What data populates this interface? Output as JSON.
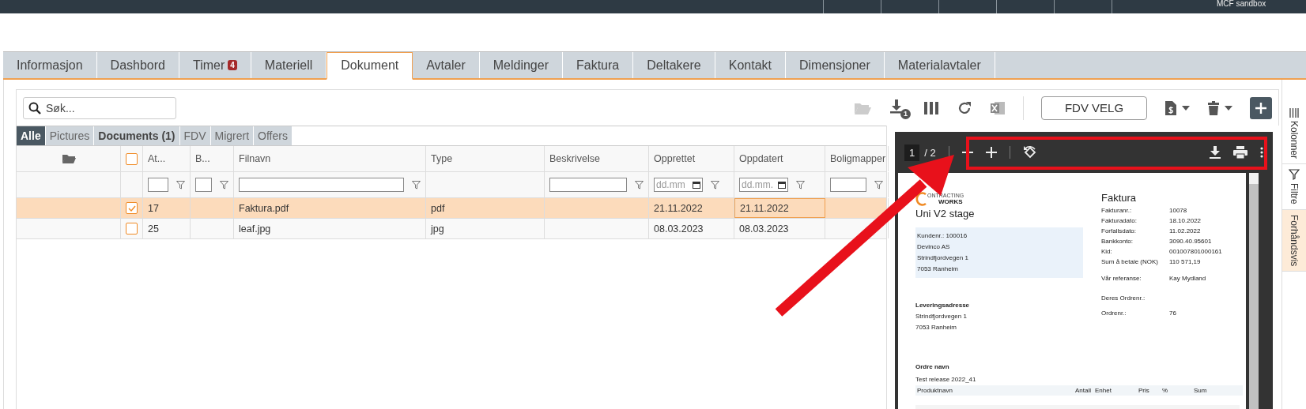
{
  "header": {
    "account": "MCF sandbox"
  },
  "tabs": [
    {
      "label": "Informasjon",
      "selected": false
    },
    {
      "label": "Dashbord",
      "selected": false
    },
    {
      "label": "Timer",
      "badge": "4",
      "selected": false
    },
    {
      "label": "Materiell",
      "selected": false
    },
    {
      "label": "Dokument",
      "selected": true
    },
    {
      "label": "Avtaler",
      "selected": false
    },
    {
      "label": "Meldinger",
      "selected": false
    },
    {
      "label": "Faktura",
      "selected": false
    },
    {
      "label": "Deltakere",
      "selected": false
    },
    {
      "label": "Kontakt",
      "selected": false
    },
    {
      "label": "Dimensjoner",
      "selected": false
    },
    {
      "label": "Materialavtaler",
      "selected": false
    }
  ],
  "search": {
    "placeholder": "Søk..."
  },
  "toolbar": {
    "download_badge": "1",
    "fdv_button": "FDV VELG"
  },
  "side_tabs": [
    {
      "label": "Kolonner",
      "kind": "plain",
      "selected": false
    },
    {
      "label": "Filtre",
      "kind": "filter",
      "selected": false
    },
    {
      "label": "Forhåndsvis",
      "kind": "plain",
      "selected": true
    }
  ],
  "categories": [
    {
      "label": "Alle",
      "selected": true
    },
    {
      "label": "Pictures",
      "selected": false
    },
    {
      "label": "Documents (1)",
      "selected": false
    },
    {
      "label": "FDV",
      "selected": false
    },
    {
      "label": "Migrert",
      "selected": false
    },
    {
      "label": "Offers",
      "selected": false
    }
  ],
  "header_checkbox": {
    "checked": false
  },
  "columns": [
    {
      "label": "At...",
      "kind": "text"
    },
    {
      "label": "B...",
      "kind": "text"
    },
    {
      "label": "Filnavn",
      "kind": "text"
    },
    {
      "label": "Type",
      "kind": "plain"
    },
    {
      "label": "Beskrivelse",
      "kind": "text"
    },
    {
      "label": "Opprettet",
      "kind": "date",
      "placeholder": "dd.mm"
    },
    {
      "label": "Oppdatert",
      "kind": "date",
      "placeholder": "dd.mm."
    },
    {
      "label": "Boligmapper",
      "kind": "text"
    }
  ],
  "rows": [
    {
      "selected": true,
      "checked": true,
      "cells": [
        "17",
        "",
        "Faktura.pdf",
        "pdf",
        "",
        "21.11.2022",
        "21.11.2022",
        ""
      ]
    },
    {
      "selected": false,
      "checked": false,
      "cells": [
        "25",
        "",
        "leaf.jpg",
        "jpg",
        "",
        "08.03.2023",
        "08.03.2023",
        ""
      ]
    }
  ],
  "viewer": {
    "page": "1",
    "total": "/ 2"
  },
  "invoice": {
    "logo_top": "ONTRACTING",
    "logo_bottom": "WORKS",
    "company": "Uni V2 stage",
    "customer_lines": [
      "Kundenr.: 100016",
      "Devinco AS",
      "Strindfjordvegen 1",
      "7053  Ranheim"
    ],
    "title": "Faktura",
    "fields": [
      {
        "label": "Fakturanr.:",
        "value": "10078"
      },
      {
        "label": "Fakturadato:",
        "value": "18.10.2022"
      },
      {
        "label": "Forfallsdato:",
        "value": "11.02.2022"
      },
      {
        "label": "Bankkonto:",
        "value": "3090.40.95601"
      },
      {
        "label": "Kid:",
        "value": "001007801000161"
      },
      {
        "label": "Sum å betale (NOK)",
        "value": "110 571,19"
      }
    ],
    "refs": [
      {
        "label": "Vår referanse:",
        "value": "Kay Mydland"
      },
      {
        "label": "Deres Ordrenr.:"
      },
      {
        "label": "Ordrenr.:",
        "value": "76"
      }
    ],
    "delivery_title": "Leveringsadresse",
    "delivery_lines": [
      "Strindfjordvegen 1",
      "7053 Ranheim"
    ],
    "order_title": "Ordre navn",
    "order_text": "Test release 2022_41",
    "columns": [
      "Produktnavn",
      "Antall",
      "Enhet",
      "Pris",
      "%",
      "Sum"
    ]
  },
  "annotations": {
    "highlight_frame": true,
    "arrow": true
  }
}
